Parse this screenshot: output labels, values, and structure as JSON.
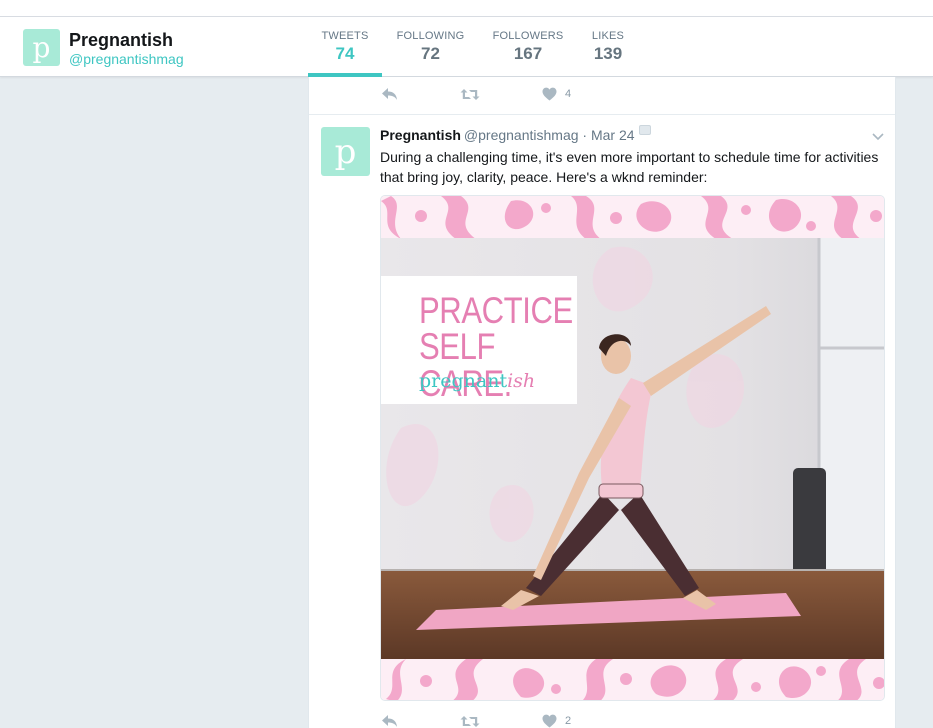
{
  "profile": {
    "avatar_letter": "p",
    "name": "Pregnantish",
    "handle": "@pregnantishmag"
  },
  "nav": [
    {
      "label": "TWEETS",
      "value": "74",
      "active": true
    },
    {
      "label": "FOLLOWING",
      "value": "72",
      "active": false
    },
    {
      "label": "FOLLOWERS",
      "value": "167",
      "active": false
    },
    {
      "label": "LIKES",
      "value": "139",
      "active": false
    }
  ],
  "colors": {
    "accent": "#3ec6c2",
    "avatar_bg": "#a8ead7",
    "promo_pink": "#e57fb2",
    "damask_pink": "#f3a8cb"
  },
  "previous_tweet": {
    "like_count": "4"
  },
  "tweet": {
    "name": "Pregnantish",
    "handle": "@pregnantishmag",
    "separator": "·",
    "date": "Mar 24",
    "text": "During a challenging time, it's even more important to schedule time for activities that bring joy, clarity, peace. Here's a wknd reminder:",
    "like_count": "2",
    "media": {
      "headline_line1": "PRACTICE",
      "headline_line2": "SELF CARE.",
      "brand_prefix": "pregnant",
      "brand_suffix": "ish"
    }
  },
  "icons": {
    "reply": "reply-icon",
    "retweet": "retweet-icon",
    "like": "heart-icon",
    "caret": "chevron-down-icon"
  }
}
